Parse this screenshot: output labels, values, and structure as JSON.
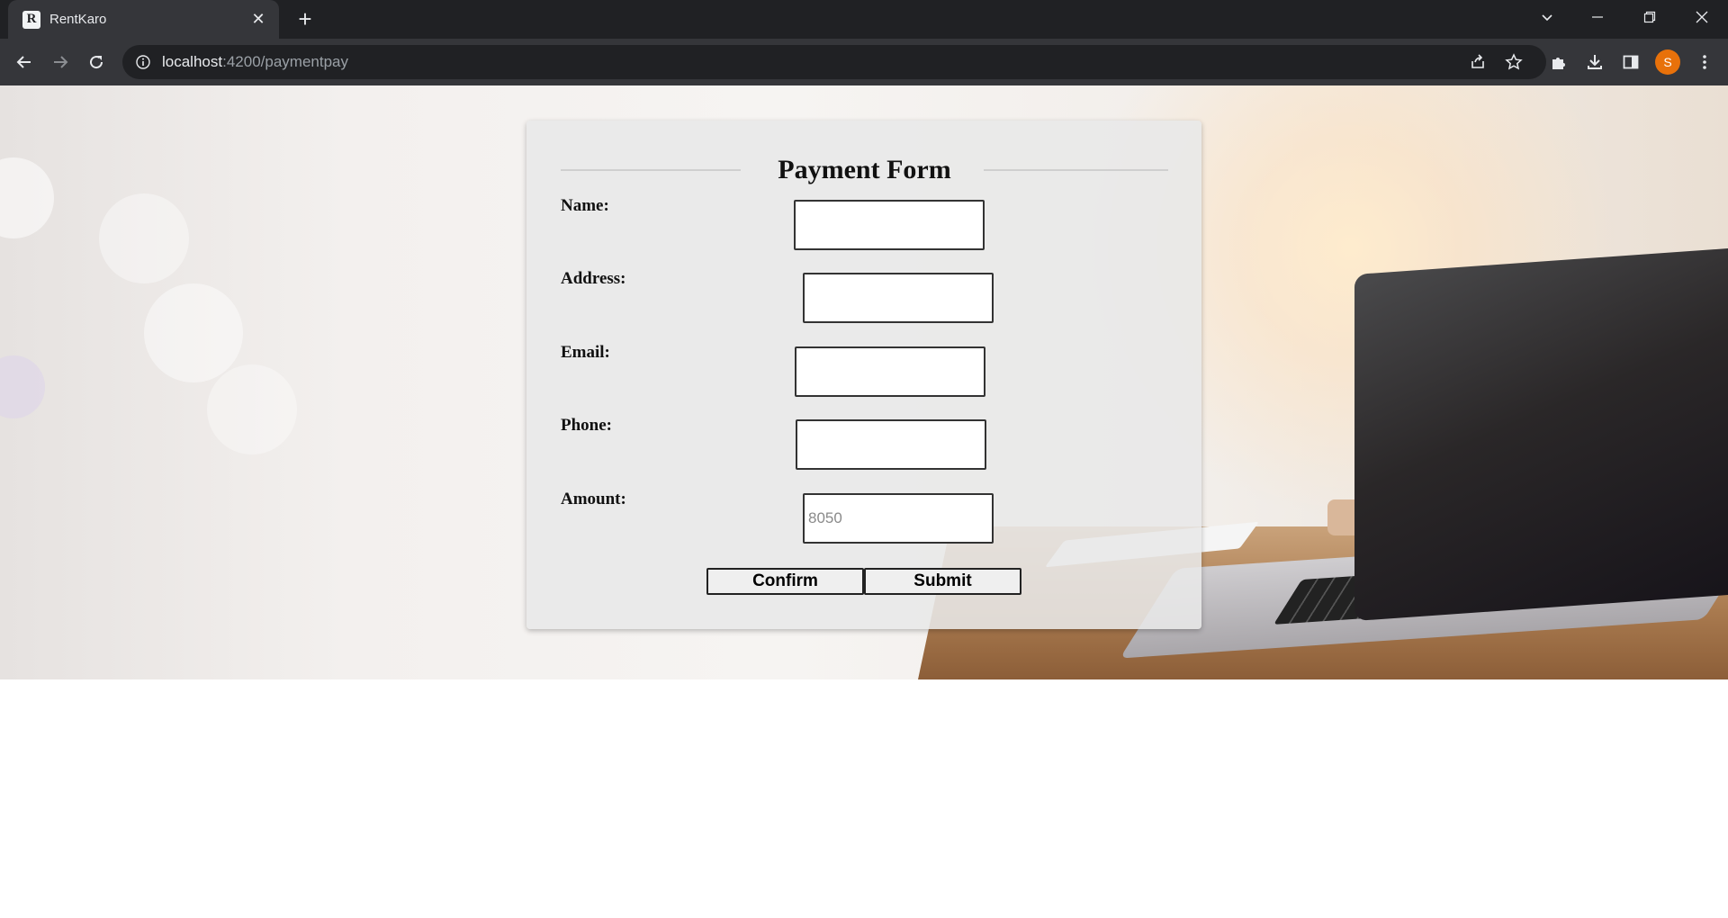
{
  "browser": {
    "tab_title": "RentKaro",
    "favicon_letter": "R",
    "url_host": "localhost",
    "url_path": ":4200/paymentpay",
    "profile_initial": "S"
  },
  "form": {
    "title": "Payment Form",
    "fields": [
      {
        "label": "Name:",
        "value": "",
        "placeholder": ""
      },
      {
        "label": "Address:",
        "value": "",
        "placeholder": ""
      },
      {
        "label": "Email:",
        "value": "",
        "placeholder": ""
      },
      {
        "label": "Phone:",
        "value": "",
        "placeholder": ""
      },
      {
        "label": "Amount:",
        "value": "",
        "placeholder": "8050"
      }
    ],
    "confirm_label": "Confirm",
    "submit_label": "Submit"
  },
  "colors": {
    "chrome_dark": "#202124",
    "chrome_toolbar": "#35363a",
    "avatar": "#e8710a"
  }
}
